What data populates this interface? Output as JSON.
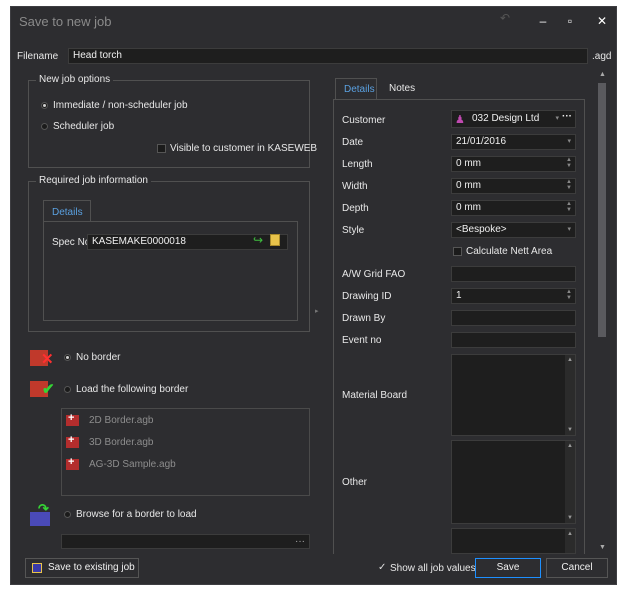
{
  "window": {
    "title": "Save to new job",
    "controls": [
      "‒",
      "▫",
      "✕"
    ]
  },
  "filename": {
    "label": "Filename",
    "value": "Head torch",
    "suffix": ".agd"
  },
  "new_job_options": {
    "title": "New job options",
    "immediate": "Immediate / non-scheduler job",
    "scheduler": "Scheduler job",
    "visible": "Visible to customer in KASEWEB"
  },
  "required_info": {
    "title": "Required job information",
    "tab": "Details",
    "spec_label": "Spec No",
    "spec_value": "KASEMAKE0000018"
  },
  "borders": {
    "no_border": "No border",
    "load_border": "Load the following border",
    "files": [
      "2D Border.agb",
      "3D Border.agb",
      "AG-3D Sample.agb"
    ],
    "browse": "Browse for a border to load",
    "browse_button": "···"
  },
  "right_tabs": {
    "details": "Details",
    "notes": "Notes"
  },
  "details": {
    "customer_label": "Customer",
    "customer_value": "032 Design Ltd",
    "date_label": "Date",
    "date_value": "21/01/2016",
    "length_label": "Length",
    "length_value": "0 mm",
    "width_label": "Width",
    "width_value": "0 mm",
    "depth_label": "Depth",
    "depth_value": "0 mm",
    "style_label": "Style",
    "style_value": "<Bespoke>",
    "calc_nett": "Calculate Nett Area",
    "aw_label": "A/W Grid FAO",
    "drawing_id_label": "Drawing ID",
    "drawing_id_value": "1",
    "drawn_by_label": "Drawn By",
    "event_no_label": "Event no",
    "material_board_label": "Material Board",
    "other_label": "Other"
  },
  "footer": {
    "save_existing": "Save to existing job",
    "show_all": "Show all job values",
    "save": "Save",
    "cancel": "Cancel"
  },
  "colors": {
    "accent": "#1e90ff",
    "tab_blue": "#5aa0e0",
    "background": "#2d2d30",
    "field": "#1e1e1e"
  }
}
